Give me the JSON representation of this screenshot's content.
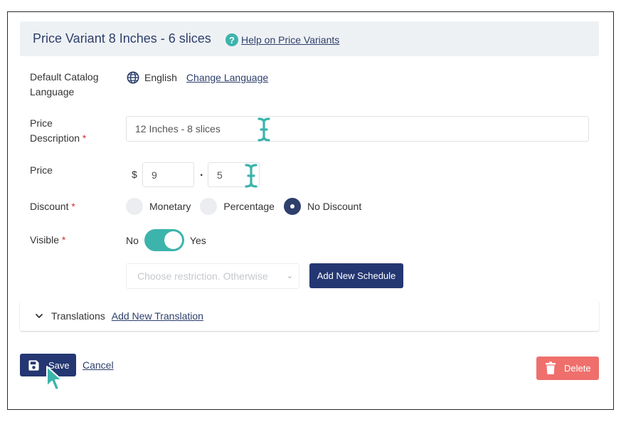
{
  "header": {
    "title": "Price Variant 8 Inches - 6 slices",
    "help_icon": "question-circle-icon",
    "help_link": "Help on Price Variants"
  },
  "catalog_language": {
    "label_line1": "Default Catalog",
    "label_line2": "Language",
    "icon": "globe-icon",
    "value": "English",
    "change_link": "Change Language"
  },
  "price_description": {
    "label_line1": "Price",
    "label_line2": "Description",
    "required_mark": "*",
    "value": "12 Inches - 8 slices"
  },
  "price": {
    "label": "Price",
    "currency_symbol": "$",
    "integer_value": "9",
    "separator": ".",
    "decimal_value": "5"
  },
  "discount": {
    "label": "Discount",
    "required_mark": "*",
    "options": [
      "Monetary",
      "Percentage",
      "No Discount"
    ],
    "selected": "No Discount"
  },
  "visible": {
    "label": "Visible",
    "required_mark": "*",
    "off_label": "No",
    "on_label": "Yes",
    "is_on": true
  },
  "schedule": {
    "select_placeholder": "Choose restriction. Otherwise",
    "add_button": "Add New Schedule"
  },
  "translations": {
    "label": "Translations",
    "add_link": "Add New Translation"
  },
  "footer": {
    "save_label": "Save",
    "cancel_label": "Cancel",
    "delete_label": "Delete"
  },
  "colors": {
    "primary": "#243772",
    "accent": "#3cb4ac",
    "danger": "#ef6f6c",
    "header_bg": "#eef1f4"
  }
}
